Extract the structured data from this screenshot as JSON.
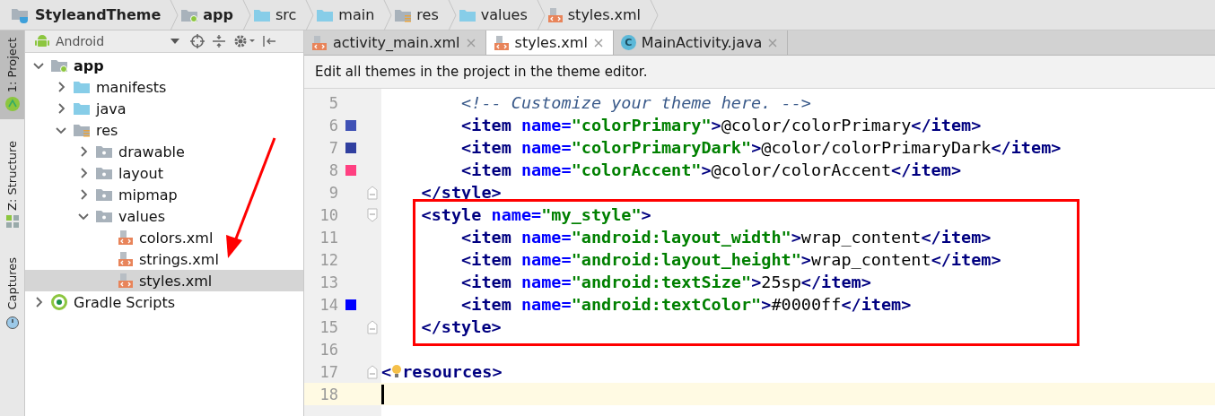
{
  "breadcrumb": [
    {
      "label": "StyleandTheme",
      "kind": "project"
    },
    {
      "label": "app",
      "kind": "module"
    },
    {
      "label": "src",
      "kind": "folder"
    },
    {
      "label": "main",
      "kind": "folder"
    },
    {
      "label": "res",
      "kind": "res"
    },
    {
      "label": "values",
      "kind": "folder"
    },
    {
      "label": "styles.xml",
      "kind": "xml"
    }
  ],
  "tool_strip": [
    {
      "label": "1: Project",
      "selected": true,
      "kind": "android"
    },
    {
      "label": "Z: Structure",
      "selected": false,
      "kind": "structure"
    },
    {
      "label": "Captures",
      "selected": false,
      "kind": "captures"
    }
  ],
  "project_panel": {
    "view": "Android",
    "tree": [
      {
        "label": "app",
        "kind": "module",
        "expanded": true,
        "selected": false,
        "children": [
          {
            "label": "manifests",
            "kind": "folder",
            "expanded": false,
            "selected": false
          },
          {
            "label": "java",
            "kind": "folder",
            "expanded": false,
            "selected": false
          },
          {
            "label": "res",
            "kind": "res",
            "expanded": true,
            "selected": false,
            "children": [
              {
                "label": "drawable",
                "kind": "resfolder",
                "expanded": false,
                "selected": false
              },
              {
                "label": "layout",
                "kind": "resfolder",
                "expanded": false,
                "selected": false
              },
              {
                "label": "mipmap",
                "kind": "resfolder",
                "expanded": false,
                "selected": false
              },
              {
                "label": "values",
                "kind": "resfolder",
                "expanded": true,
                "selected": false,
                "children": [
                  {
                    "label": "colors.xml",
                    "kind": "xml",
                    "selected": false
                  },
                  {
                    "label": "strings.xml",
                    "kind": "xml",
                    "selected": false
                  },
                  {
                    "label": "styles.xml",
                    "kind": "xml",
                    "selected": true
                  }
                ]
              }
            ]
          }
        ]
      },
      {
        "label": "Gradle Scripts",
        "kind": "gradle",
        "expanded": false,
        "selected": false
      }
    ]
  },
  "editor": {
    "tabs": [
      {
        "label": "activity_main.xml",
        "kind": "xml",
        "selected": false
      },
      {
        "label": "styles.xml",
        "kind": "xml",
        "selected": true
      },
      {
        "label": "MainActivity.java",
        "kind": "java",
        "badge": "C",
        "selected": false
      }
    ],
    "banner": "Edit all themes in the project in the theme editor.",
    "lines": [
      {
        "n": "5",
        "tokens": [
          {
            "kind": "comment",
            "text": "        <!-- Customize your theme here. -->"
          }
        ]
      },
      {
        "n": "6",
        "color": "#3f51b5",
        "tokens": [
          {
            "kind": "tag",
            "text": "        <item"
          },
          {
            "kind": "attr",
            "text": " name="
          },
          {
            "kind": "val",
            "text": "\"colorPrimary\""
          },
          {
            "kind": "tag",
            "text": ">"
          },
          {
            "kind": "text",
            "text": "@color/colorPrimary"
          },
          {
            "kind": "tag",
            "text": "</item>"
          }
        ]
      },
      {
        "n": "7",
        "color": "#303f9f",
        "tokens": [
          {
            "kind": "tag",
            "text": "        <item"
          },
          {
            "kind": "attr",
            "text": " name="
          },
          {
            "kind": "val",
            "text": "\"colorPrimaryDark\""
          },
          {
            "kind": "tag",
            "text": ">"
          },
          {
            "kind": "text",
            "text": "@color/colorPrimaryDark"
          },
          {
            "kind": "tag",
            "text": "</item>"
          }
        ]
      },
      {
        "n": "8",
        "color": "#ff4081",
        "tokens": [
          {
            "kind": "tag",
            "text": "        <item"
          },
          {
            "kind": "attr",
            "text": " name="
          },
          {
            "kind": "val",
            "text": "\"colorAccent\""
          },
          {
            "kind": "tag",
            "text": ">"
          },
          {
            "kind": "text",
            "text": "@color/colorAccent"
          },
          {
            "kind": "tag",
            "text": "</item>"
          }
        ]
      },
      {
        "n": "9",
        "kind": "fold_end",
        "tokens": [
          {
            "kind": "tag",
            "text": "    </style>"
          }
        ]
      },
      {
        "n": "10",
        "kind": "fold_start",
        "tokens": [
          {
            "kind": "tag",
            "text": "    <style"
          },
          {
            "kind": "attr",
            "text": " name="
          },
          {
            "kind": "val",
            "text": "\"my_style\""
          },
          {
            "kind": "tag",
            "text": ">"
          }
        ]
      },
      {
        "n": "11",
        "tokens": [
          {
            "kind": "tag",
            "text": "        <item"
          },
          {
            "kind": "attr",
            "text": " name="
          },
          {
            "kind": "val",
            "text": "\"android:layout_width\""
          },
          {
            "kind": "tag",
            "text": ">"
          },
          {
            "kind": "text",
            "text": "wrap_content"
          },
          {
            "kind": "tag",
            "text": "</item>"
          }
        ]
      },
      {
        "n": "12",
        "tokens": [
          {
            "kind": "tag",
            "text": "        <item"
          },
          {
            "kind": "attr",
            "text": " name="
          },
          {
            "kind": "val",
            "text": "\"android:layout_height\""
          },
          {
            "kind": "tag",
            "text": ">"
          },
          {
            "kind": "text",
            "text": "wrap_content"
          },
          {
            "kind": "tag",
            "text": "</item>"
          }
        ]
      },
      {
        "n": "13",
        "tokens": [
          {
            "kind": "tag",
            "text": "        <item"
          },
          {
            "kind": "attr",
            "text": " name="
          },
          {
            "kind": "val",
            "text": "\"android:textSize\""
          },
          {
            "kind": "tag",
            "text": ">"
          },
          {
            "kind": "text",
            "text": "25sp"
          },
          {
            "kind": "tag",
            "text": "</item>"
          }
        ]
      },
      {
        "n": "14",
        "color": "#0000ff",
        "tokens": [
          {
            "kind": "tag",
            "text": "        <item"
          },
          {
            "kind": "attr",
            "text": " name="
          },
          {
            "kind": "val",
            "text": "\"android:textColor\""
          },
          {
            "kind": "tag",
            "text": ">"
          },
          {
            "kind": "text",
            "text": "#0000ff"
          },
          {
            "kind": "tag",
            "text": "</item>"
          }
        ]
      },
      {
        "n": "15",
        "kind": "fold_end",
        "tokens": [
          {
            "kind": "tag",
            "text": "    </style>"
          }
        ]
      },
      {
        "n": "16"
      },
      {
        "n": "17",
        "kind": "fold_end",
        "bulb": true,
        "tokens": [
          {
            "kind": "tag",
            "text": "<"
          },
          {
            "kind": "tag",
            "text": "resources>"
          }
        ]
      },
      {
        "n": "18",
        "current": true
      }
    ]
  }
}
